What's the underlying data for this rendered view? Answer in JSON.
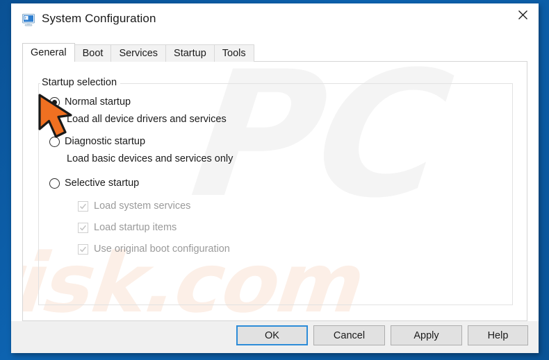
{
  "window": {
    "title": "System Configuration",
    "icon": "system-configuration-monitor-icon",
    "close_label": "✕"
  },
  "tabs": [
    {
      "label": "General",
      "active": true
    },
    {
      "label": "Boot",
      "active": false
    },
    {
      "label": "Services",
      "active": false
    },
    {
      "label": "Startup",
      "active": false
    },
    {
      "label": "Tools",
      "active": false
    }
  ],
  "groupbox": {
    "legend": "Startup selection"
  },
  "startup_options": [
    {
      "id": "normal",
      "label": "Normal startup",
      "description": "Load all device drivers and services",
      "selected": true
    },
    {
      "id": "diagnostic",
      "label": "Diagnostic startup",
      "description": "Load basic devices and services only",
      "selected": false
    },
    {
      "id": "selective",
      "label": "Selective startup",
      "description": "",
      "selected": false
    }
  ],
  "selective_options": [
    {
      "id": "load-system-services",
      "label": "Load system services",
      "checked": true,
      "enabled": false
    },
    {
      "id": "load-startup-items",
      "label": "Load startup items",
      "checked": true,
      "enabled": false
    },
    {
      "id": "use-original-boot-config",
      "label": "Use original boot configuration",
      "checked": true,
      "enabled": false
    }
  ],
  "buttons": [
    {
      "id": "ok",
      "label": "OK",
      "default": true
    },
    {
      "id": "cancel",
      "label": "Cancel",
      "default": false
    },
    {
      "id": "apply",
      "label": "Apply",
      "default": false
    },
    {
      "id": "help",
      "label": "Help",
      "default": false
    }
  ],
  "watermark": {
    "logo": "PC",
    "site": "risk.com"
  },
  "colors": {
    "desktop_blue": "#0b5ca5",
    "accent_focus": "#2d8cd8",
    "cursor_orange": "#f07021",
    "disabled_text": "#9a9a9a",
    "button_face": "#e1e1e1",
    "dialog_gray": "#f0f0f0"
  }
}
